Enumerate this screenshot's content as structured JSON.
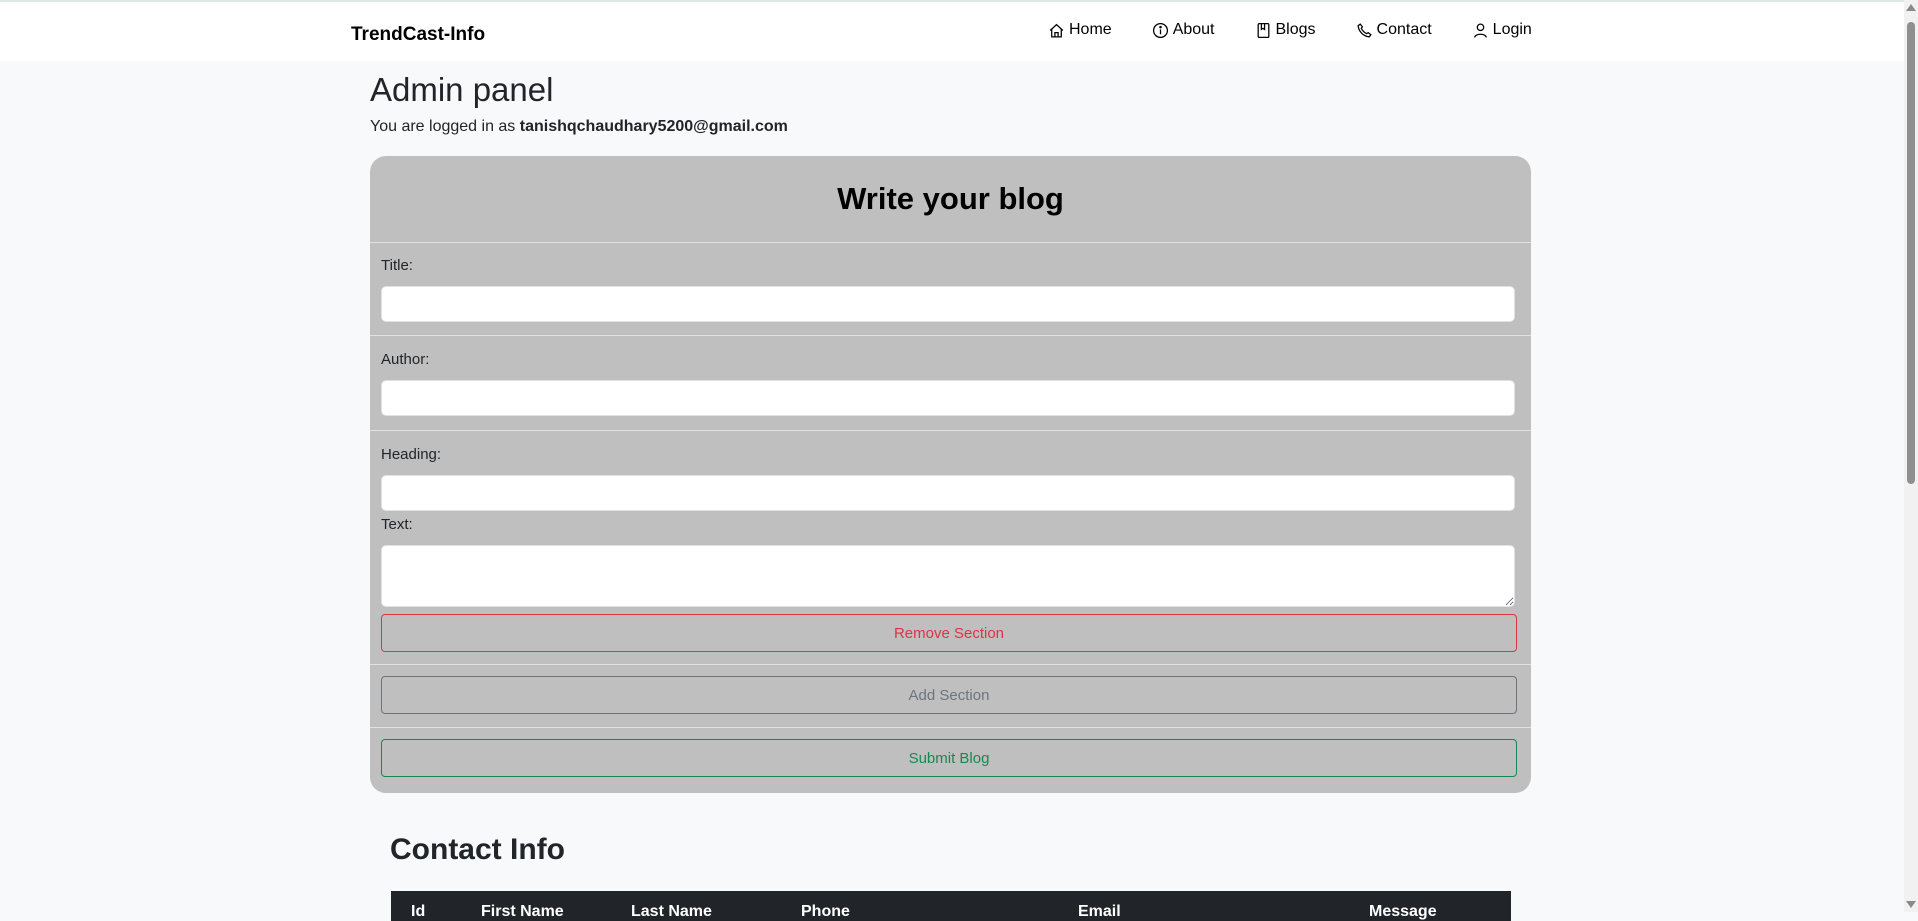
{
  "nav": {
    "brand": "TrendCast-Info",
    "links": [
      {
        "label": "Home",
        "icon": "house-icon"
      },
      {
        "label": "About",
        "icon": "info-circle-icon"
      },
      {
        "label": "Blogs",
        "icon": "bookmark-icon"
      },
      {
        "label": "Contact",
        "icon": "telephone-icon"
      },
      {
        "label": "Login",
        "icon": "person-icon"
      }
    ]
  },
  "admin": {
    "title": "Admin panel",
    "logged_prefix": "You are logged in as",
    "email": "tanishqchaudhary5200@gmail.com"
  },
  "blog_form": {
    "heading": "Write your blog",
    "title_label": "Title:",
    "title_value": "",
    "author_label": "Author:",
    "author_value": "",
    "section_heading_label": "Heading:",
    "section_heading_value": "",
    "section_text_label": "Text:",
    "section_text_value": "",
    "remove_section_label": "Remove Section",
    "add_section_label": "Add Section",
    "submit_label": "Submit Blog"
  },
  "contact": {
    "title": "Contact Info",
    "columns": [
      "Id",
      "First Name",
      "Last Name",
      "Phone",
      "Email",
      "Message"
    ]
  },
  "colors": {
    "card_bg": "#bfbfbf",
    "danger": "#dc3545",
    "secondary": "#6c757d",
    "success": "#198754",
    "table_head": "#212529"
  }
}
